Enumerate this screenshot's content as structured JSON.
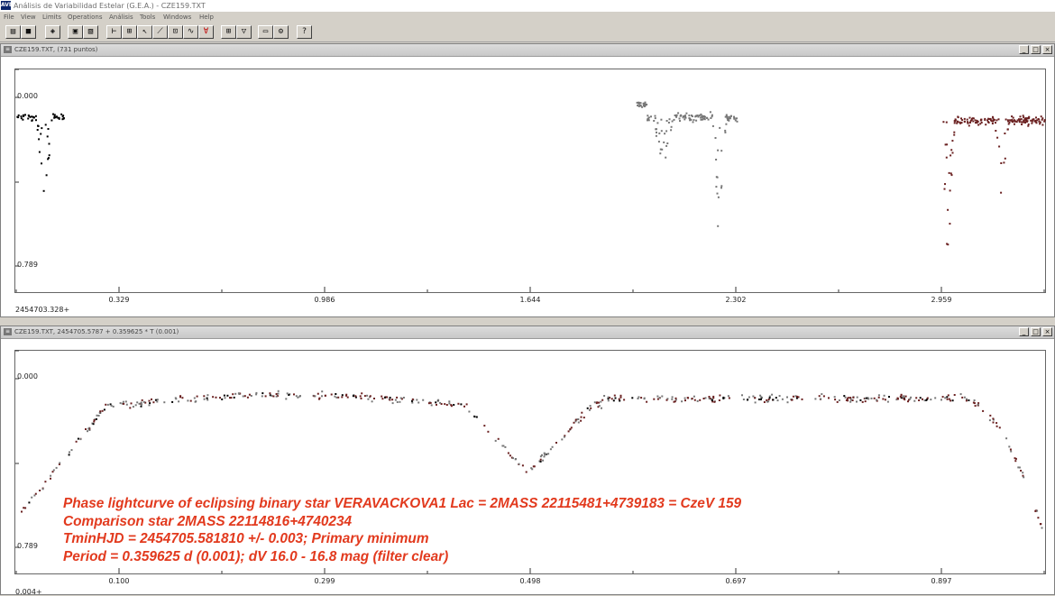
{
  "app": {
    "title": "Análisis de Variabilidad Estelar (G.E.A.) - CZE159.TXT",
    "icon_text": "AVE"
  },
  "menu": [
    "File",
    "View",
    "Limits",
    "Operations",
    "Análisis",
    "Tools",
    "Windows",
    "Help"
  ],
  "toolbar_icons": [
    "open-folder-icon",
    "save-icon",
    "cube-icon",
    "screen-icon",
    "screen-arrow-icon",
    "range-icon",
    "fit-icon",
    "pointer-icon",
    "line-icon",
    "zoom-icon",
    "filter-icon",
    "grid-icon",
    "funnel-icon",
    "window-icon",
    "tool-icon",
    "help-icon"
  ],
  "window_buttons": [
    "_",
    "□",
    "×"
  ],
  "lightcurve": {
    "title": "CZE159.TXT, (731 puntos)",
    "y_top": "0.000",
    "y_bottom": "0.789",
    "x_origin": "2454703.328+",
    "x_ticks": [
      "0.329",
      "0.986",
      "1.644",
      "2.302",
      "2.959"
    ],
    "series_colors": [
      "#000000",
      "#777777",
      "#6a2020"
    ]
  },
  "phasecurve": {
    "title": "CZE159.TXT, 2454705.5787 + 0.359625 * T (0.001)",
    "y_top": "0.000",
    "y_bottom": "0.789",
    "x_origin": "0.004+",
    "x_ticks": [
      "0.100",
      "0.299",
      "0.498",
      "0.697",
      "0.897"
    ],
    "series_colors": [
      "#000000",
      "#777777",
      "#6a2020"
    ]
  },
  "caption": [
    "Phase lightcurve of eclipsing binary star VERAVACKOVA1 Lac = 2MASS 22115481+4739183 = CzeV 159",
    "Comparison star 2MASS 22114816+4740234",
    "TminHJD = 2454705.581810 +/- 0.003; Primary minimum",
    "Period = 0.359625 d (0.001); dV 16.0 - 16.8 mag (filter clear)"
  ],
  "caption_color": "#e23a1e"
}
